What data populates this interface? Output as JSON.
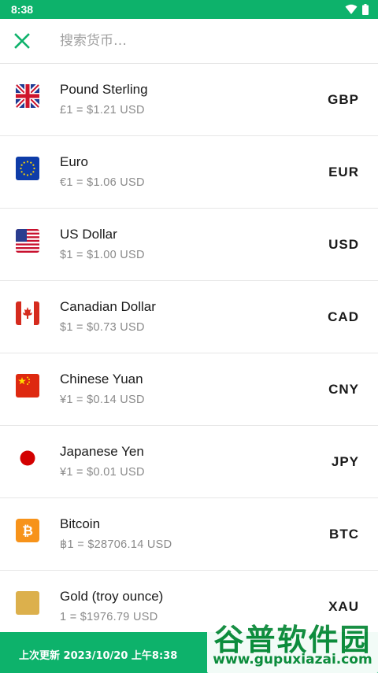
{
  "status_bar": {
    "time": "8:38",
    "icons": [
      "wifi-icon",
      "battery-icon"
    ]
  },
  "search": {
    "placeholder": "搜索货币…",
    "value": ""
  },
  "currencies": [
    {
      "name": "Pound Sterling",
      "rate": "£1 = $1.21 USD",
      "code": "GBP",
      "icon": "uk-flag-icon"
    },
    {
      "name": "Euro",
      "rate": "€1 = $1.06 USD",
      "code": "EUR",
      "icon": "eu-flag-icon"
    },
    {
      "name": "US Dollar",
      "rate": "$1 = $1.00 USD",
      "code": "USD",
      "icon": "us-flag-icon"
    },
    {
      "name": "Canadian Dollar",
      "rate": "$1 = $0.73 USD",
      "code": "CAD",
      "icon": "canada-flag-icon"
    },
    {
      "name": "Chinese Yuan",
      "rate": "¥1 = $0.14 USD",
      "code": "CNY",
      "icon": "china-flag-icon"
    },
    {
      "name": "Japanese Yen",
      "rate": "¥1 = $0.01 USD",
      "code": "JPY",
      "icon": "japan-flag-icon"
    },
    {
      "name": "Bitcoin",
      "rate": "฿1 = $28706.14 USD",
      "code": "BTC",
      "icon": "bitcoin-icon"
    },
    {
      "name": "Gold (troy ounce)",
      "rate": "1 = $1976.79 USD",
      "code": "XAU",
      "icon": "gold-icon"
    }
  ],
  "footer": {
    "last_updated": "上次更新 2023/10/20 上午8:38"
  },
  "watermark": {
    "title": "谷普软件园",
    "url": "www.gupuxiazai.com"
  },
  "colors": {
    "brand": "#0db26b",
    "watermark": "#0c8a3a"
  }
}
